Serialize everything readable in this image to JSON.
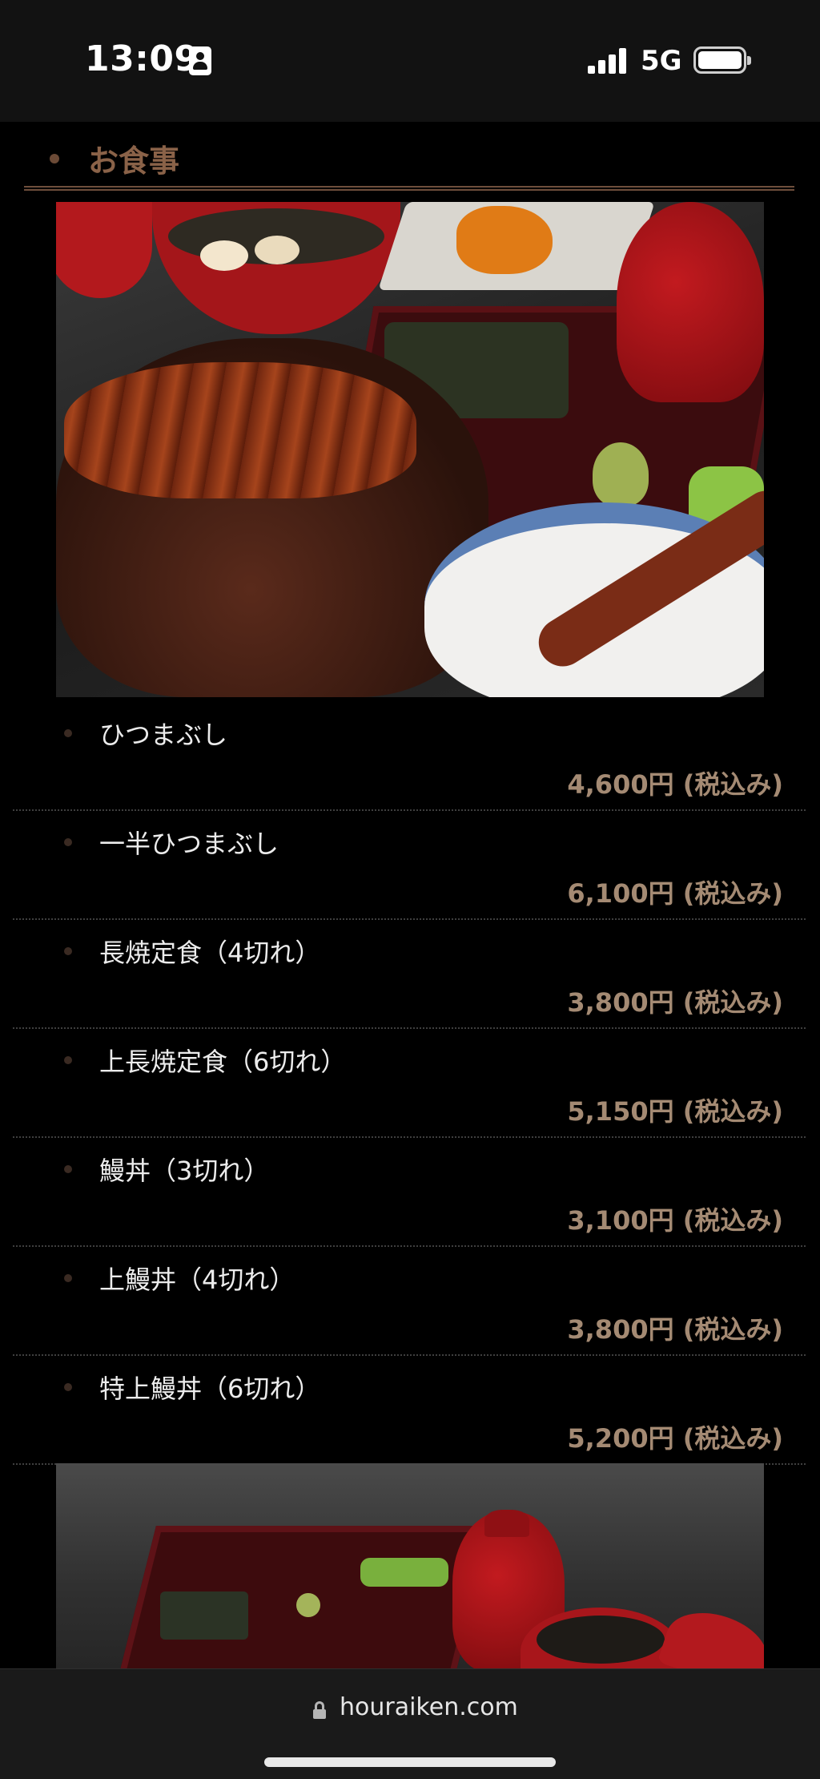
{
  "status_bar": {
    "time": "13:09",
    "network": "5G",
    "icons": [
      "contact-card-icon",
      "cellular-signal-icon",
      "battery-icon"
    ]
  },
  "section": {
    "title": "お食事"
  },
  "menu": {
    "items": [
      {
        "name": "ひつまぶし",
        "price": "4,600円 (税込み)"
      },
      {
        "name": "一半ひつまぶし",
        "price": "6,100円 (税込み)"
      },
      {
        "name": "長焼定食（4切れ）",
        "price": "3,800円 (税込み)"
      },
      {
        "name": "上長焼定食（6切れ）",
        "price": "5,150円 (税込み)"
      },
      {
        "name": "鰻丼（3切れ）",
        "price": "3,100円 (税込み)"
      },
      {
        "name": "上鰻丼（4切れ）",
        "price": "3,800円 (税込み)"
      },
      {
        "name": "特上鰻丼（6切れ）",
        "price": "5,200円 (税込み)"
      }
    ]
  },
  "browser": {
    "url": "houraiken.com"
  },
  "colors": {
    "accent_brown": "#8a6248",
    "price_tan": "#a48a73",
    "background": "#000000"
  }
}
